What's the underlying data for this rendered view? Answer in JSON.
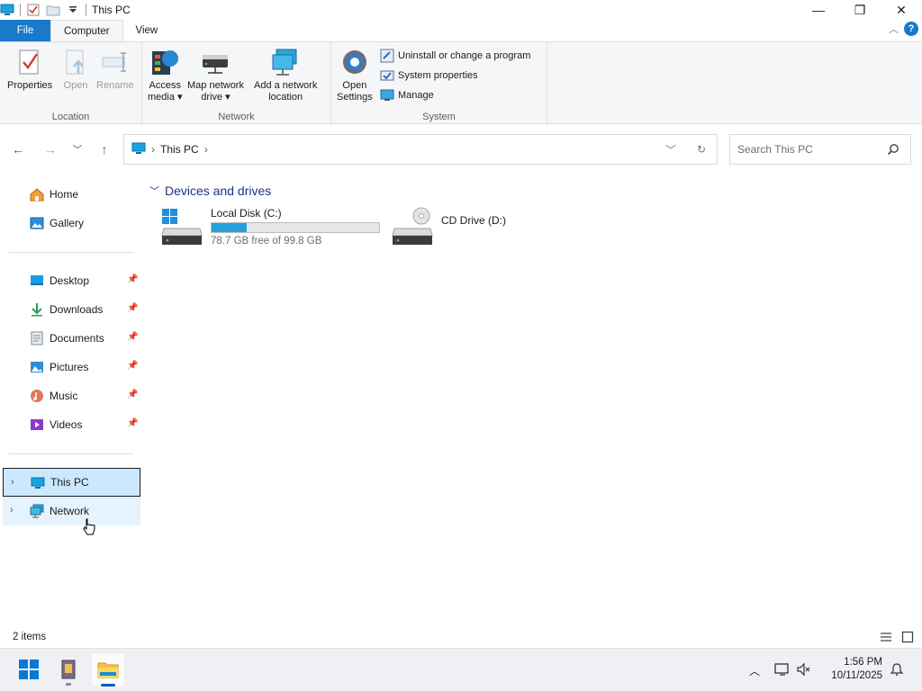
{
  "window": {
    "title": "This PC",
    "controls": {
      "minimize": "—",
      "maximize": "❐",
      "close": "✕"
    }
  },
  "ribbon_tabs": {
    "file": "File",
    "computer": "Computer",
    "view": "View",
    "help": "?"
  },
  "ribbon": {
    "location": {
      "label": "Location",
      "properties": "Properties",
      "open": "Open",
      "rename": "Rename"
    },
    "network": {
      "label": "Network",
      "access_media_1": "Access",
      "access_media_2": "media ▾",
      "map_drive_1": "Map network",
      "map_drive_2": "drive ▾",
      "add_location_1": "Add a network",
      "add_location_2": "location"
    },
    "system": {
      "label": "System",
      "open_settings_1": "Open",
      "open_settings_2": "Settings",
      "uninstall": "Uninstall or change a program",
      "system_properties": "System properties",
      "manage": "Manage"
    }
  },
  "address": {
    "crumb": "This PC",
    "search_placeholder": "Search This PC"
  },
  "nav_pane": {
    "home": "Home",
    "gallery": "Gallery",
    "pinned": [
      "Desktop",
      "Downloads",
      "Documents",
      "Pictures",
      "Music",
      "Videos"
    ],
    "this_pc": "This PC",
    "network": "Network"
  },
  "content": {
    "group_header": "Devices and drives",
    "drives": [
      {
        "name": "Local Disk (C:)",
        "free_text": "78.7 GB free of 99.8 GB",
        "used_fraction": 0.21
      },
      {
        "name": "CD Drive (D:)"
      }
    ]
  },
  "status": {
    "items": "2 items"
  },
  "taskbar": {
    "time": "1:56 PM",
    "date": "10/11/2025"
  },
  "colors": {
    "accent": "#1979ca",
    "selection": "#cce8ff",
    "bar_fill": "#26a0da"
  }
}
